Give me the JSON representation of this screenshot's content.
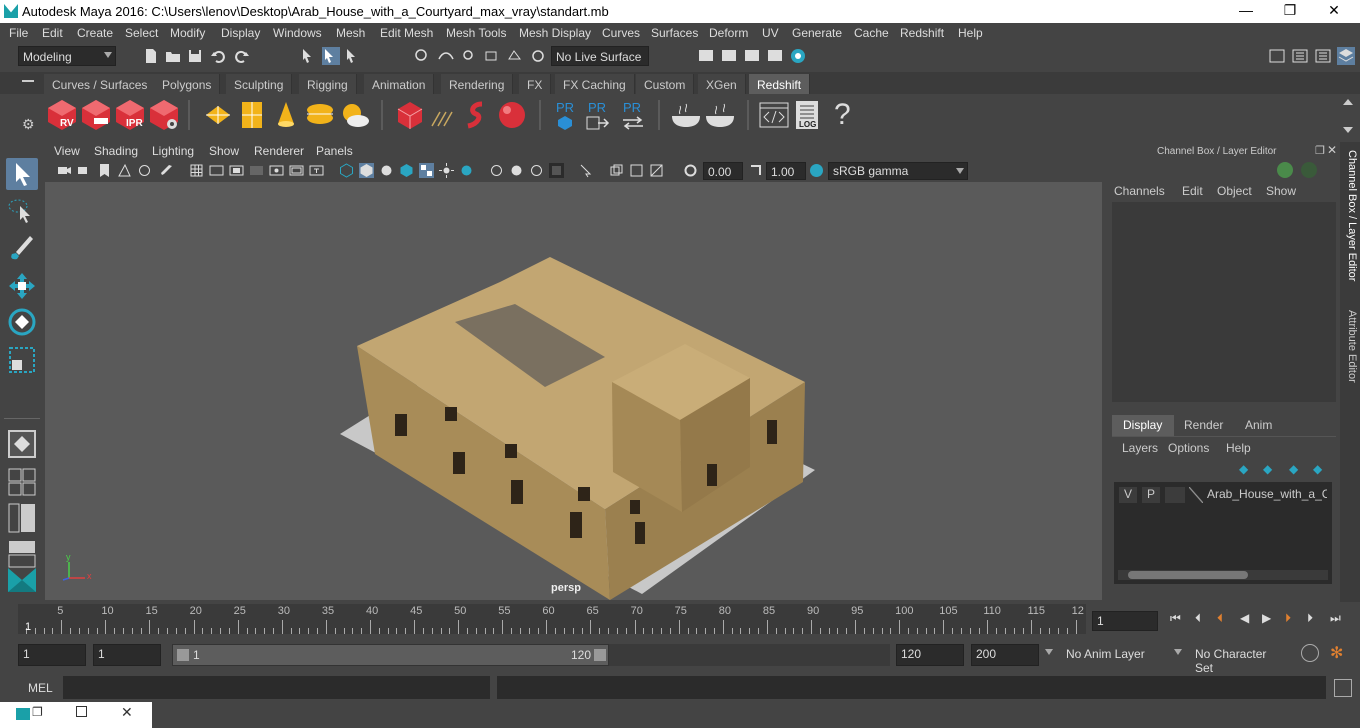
{
  "window": {
    "title": "Autodesk Maya 2016: C:\\Users\\lenov\\Desktop\\Arab_House_with_a_Courtyard_max_vray\\standart.mb",
    "minimize": "—",
    "maximize": "❐",
    "close": "✕"
  },
  "menubar": [
    "File",
    "Edit",
    "Create",
    "Select",
    "Modify",
    "Display",
    "Windows",
    "Mesh",
    "Edit Mesh",
    "Mesh Tools",
    "Mesh Display",
    "Curves",
    "Surfaces",
    "Deform",
    "UV",
    "Generate",
    "Cache",
    "Redshift",
    "Help"
  ],
  "statusline": {
    "mode": "Modeling",
    "live_surface": "No Live Surface"
  },
  "shelf_tabs": [
    "Curves / Surfaces",
    "Polygons",
    "Sculpting",
    "Rigging",
    "Animation",
    "Rendering",
    "FX",
    "FX Caching",
    "Custom",
    "XGen",
    "Redshift"
  ],
  "active_shelf_tab": "Redshift",
  "shelf_labels": {
    "rv": "RV",
    "ipr": "IPR",
    "pr": "PR",
    "log": "LOG",
    "help": "?"
  },
  "viewport": {
    "menus": [
      "View",
      "Shading",
      "Lighting",
      "Show",
      "Renderer",
      "Panels"
    ],
    "exposure": "0.00",
    "gamma": "1.00",
    "colorspace": "sRGB gamma",
    "camera_label": "persp",
    "axis_y": "y",
    "axis_x": "x"
  },
  "channel_box": {
    "title": "Channel Box / Layer Editor",
    "menus": [
      "Channels",
      "Edit",
      "Object",
      "Show"
    ],
    "layer_tabs": [
      "Display",
      "Render",
      "Anim"
    ],
    "layer_menus": [
      "Layers",
      "Options",
      "Help"
    ],
    "layer": {
      "v": "V",
      "p": "P",
      "name": "Arab_House_with_a_Cou"
    }
  },
  "side_tabs": [
    "Channel Box / Layer Editor",
    "Attribute Editor"
  ],
  "timeslider": {
    "ticks": [
      "5",
      "10",
      "15",
      "20",
      "25",
      "30",
      "35",
      "40",
      "45",
      "50",
      "55",
      "60",
      "65",
      "70",
      "75",
      "80",
      "85",
      "90",
      "95",
      "100",
      "105",
      "110",
      "115",
      "12"
    ],
    "current_marker": "1",
    "current_frame": "1"
  },
  "range": {
    "start": "1",
    "playback_start": "1",
    "slider_start": "1",
    "slider_end": "120",
    "playback_end": "120",
    "end": "200",
    "anim_layer": "No Anim Layer",
    "character_set": "No Character Set"
  },
  "cmdline": {
    "label": "MEL"
  },
  "colors": {
    "accent": "#1aa0a8",
    "redshift_red": "#d9303a",
    "shelf_yellow": "#f2b31a",
    "pr_blue": "#2a8fd6",
    "house_wall": "#b69a62"
  }
}
